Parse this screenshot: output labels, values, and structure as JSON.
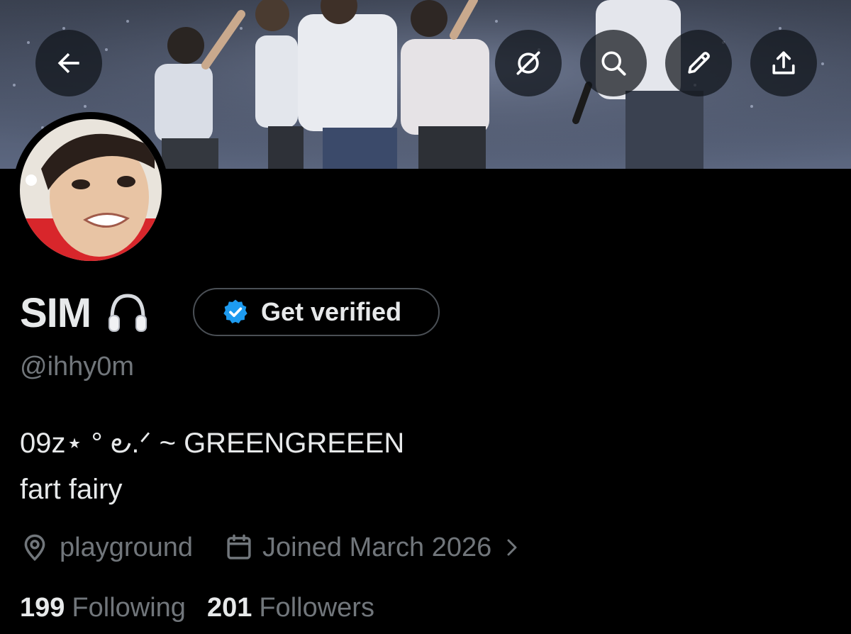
{
  "header": {
    "back_icon": "arrow-left-icon",
    "actions": [
      "radar-off-icon",
      "search-icon",
      "pencil-icon",
      "share-icon"
    ]
  },
  "profile": {
    "name": "SIM",
    "name_emoji": "headphones-icon",
    "verify_label": "Get verified",
    "verify_badge_color": "#1d9bf0",
    "handle": "@ihhy0m",
    "bio_line1": "09z⋆ ° ౿.ᐟ ~ GREENGREEEN",
    "bio_line2": "fart fairy",
    "location": "playground",
    "joined": "Joined March 2026"
  },
  "stats": {
    "following_count": "199",
    "following_label": "Following",
    "followers_count": "201",
    "followers_label": "Followers"
  },
  "colors": {
    "background": "#000000",
    "primary_text": "#e7e9ea",
    "secondary_text": "#71767b"
  }
}
